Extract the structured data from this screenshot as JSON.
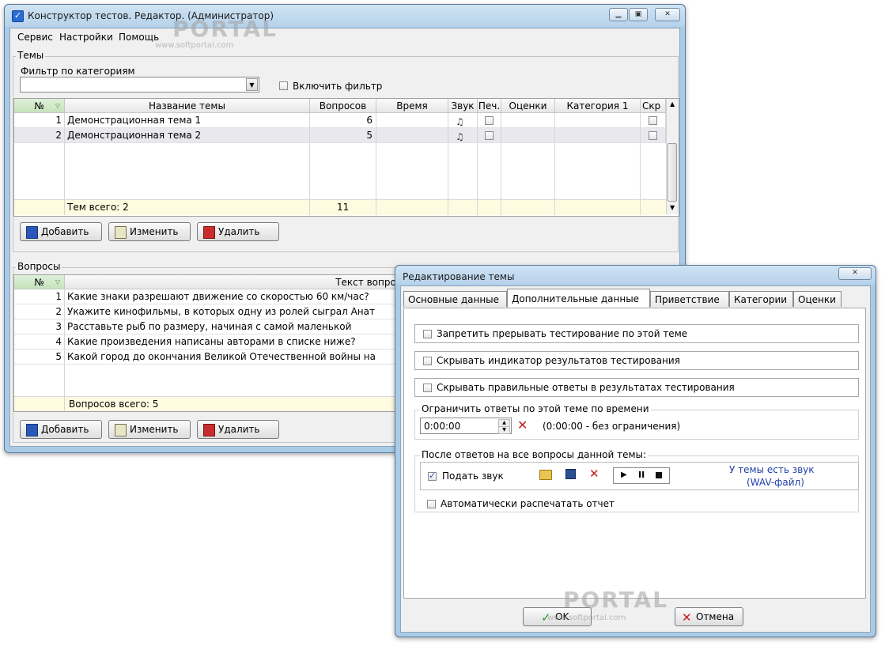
{
  "main_window": {
    "title": "Конструктор тестов. Редактор. (Администратор)",
    "controls": [
      "_",
      "□",
      "✕"
    ],
    "menu": [
      "Сервис",
      "Настройки",
      "Помощь"
    ],
    "themes_group": "Темы",
    "filter_label": "Фильтр по категориям",
    "filter_value": "",
    "enable_filter_label": "Включить фильтр",
    "themes_table": {
      "headers": [
        "№",
        "Название темы",
        "Вопросов",
        "Время",
        "Звук",
        "Печ.",
        "Оценки",
        "Категория 1",
        "Скр"
      ],
      "rows": [
        {
          "num": "1",
          "name": "Демонстрационная тема 1",
          "count": "6"
        },
        {
          "num": "2",
          "name": "Демонстрационная тема 2",
          "count": "5"
        }
      ],
      "footer_label": "Тем всего: 2",
      "footer_count": "11"
    },
    "theme_buttons": {
      "add": "Добавить",
      "edit": "Изменить",
      "delete": "Удалить"
    },
    "questions_group": "Вопросы",
    "questions_table": {
      "headers": [
        "№",
        "Текст вопроса"
      ],
      "rows": [
        {
          "num": "1",
          "text": "Какие знаки разрешают движение со скоростью 60 км/час?"
        },
        {
          "num": "2",
          "text": "Укажите кинофильмы, в которых одну из ролей сыграл Анат"
        },
        {
          "num": "3",
          "text": "Расставьте рыб по размеру, начиная с самой маленькой"
        },
        {
          "num": "4",
          "text": "Какие произведения написаны авторами в списке ниже?"
        },
        {
          "num": "5",
          "text": "Какой город до окончания Великой Отечественной войны на"
        }
      ],
      "footer_label": "Вопросов всего: 5"
    },
    "question_buttons": {
      "add": "Добавить",
      "edit": "Изменить",
      "delete": "Удалить"
    }
  },
  "dialog": {
    "title": "Редактирование темы",
    "close": "✕",
    "tabs": [
      "Основные данные",
      "Дополнительные данные",
      "Приветствие",
      "Категории",
      "Оценки"
    ],
    "selected_tab": "Дополнительные данные",
    "opt_no_interrupt": "Запретить прерывать тестирование по этой теме",
    "opt_hide_indicator": "Скрывать индикатор результатов тестирования",
    "opt_hide_answers": "Скрывать правильные ответы в результатах тестирования",
    "time_group": "Ограничить ответы по этой теме по времени",
    "time_value": "0:00:00",
    "time_hint": "(0:00:00 - без ограничения)",
    "after_group": "После ответов на все вопросы данной темы:",
    "play_sound_label": "Подать звук",
    "sound_info": "У темы есть звук\n(WAV-файл)",
    "sound_info_line1": "У темы есть звук",
    "sound_info_line2": "(WAV-файл)",
    "auto_print_label": "Автоматически распечатать отчет",
    "ok": "OK",
    "cancel": "Отмена"
  },
  "watermark": {
    "brand": "PORTAL",
    "url": "www.softportal.com"
  },
  "colors": {
    "accent": "#1b4fa5",
    "header_selected": "#cfe6c8",
    "footer_row": "#fffbe0",
    "link_text": "#1f3fa8"
  }
}
